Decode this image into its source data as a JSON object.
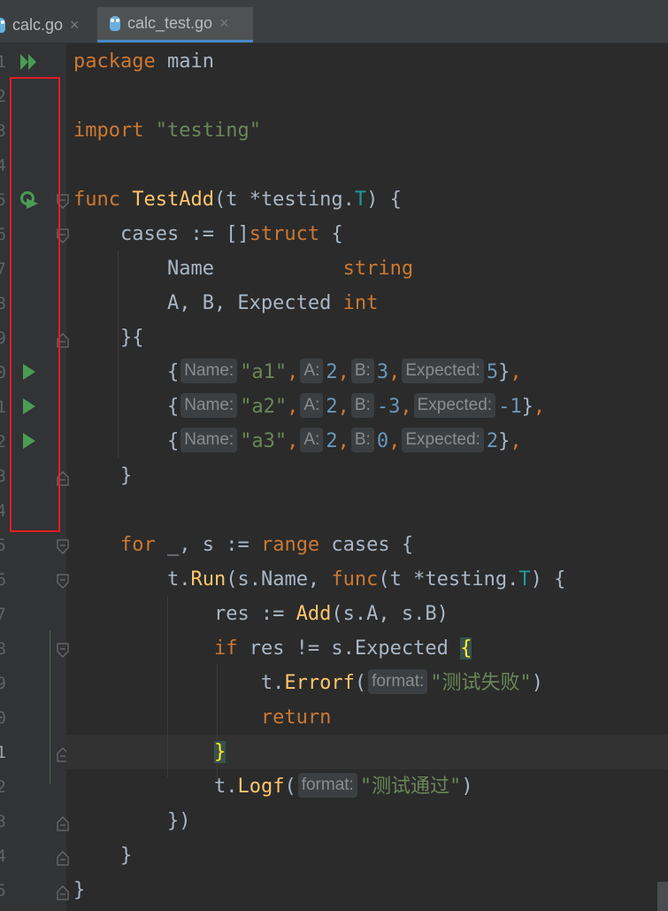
{
  "tabs": [
    {
      "label": "calc.go",
      "close": "×",
      "active": false
    },
    {
      "label": "calc_test.go",
      "close": "×",
      "active": true
    }
  ],
  "gutter": {
    "line_numbers": [
      "1",
      "2",
      "3",
      "4",
      "5",
      "6",
      "7",
      "8",
      "9",
      "0",
      "1",
      "2",
      "3",
      "4",
      "5",
      "6",
      "7",
      "8",
      "9",
      "0",
      "1",
      "2",
      "3",
      "4",
      "5"
    ],
    "current_line": 21
  },
  "code": {
    "l1": {
      "kw": "package",
      "rest": " main"
    },
    "l3": {
      "kw": "import",
      "str": "\"testing\""
    },
    "l5": {
      "kw": "func",
      "fn": "TestAdd",
      "p1": "(t *",
      "t1": "testing",
      "p2": ".",
      "t2": "T",
      "p3": ") {"
    },
    "l6": {
      "a": "    cases := []",
      "kw": "struct",
      "b": " {"
    },
    "l7": {
      "a": "        Name           ",
      "kw": "string"
    },
    "l8": {
      "a": "        A, B, Expected ",
      "kw": "int"
    },
    "l9": {
      "a": "    }{"
    },
    "cases": [
      {
        "name_hint": "Name:",
        "name": "\"a1\"",
        "a_hint": "A:",
        "a": "2",
        "b_hint": "B:",
        "b": "3",
        "e_hint": "Expected:",
        "e": "5"
      },
      {
        "name_hint": "Name:",
        "name": "\"a2\"",
        "a_hint": "A:",
        "a": "2",
        "b_hint": "B:",
        "b": "-3",
        "e_hint": "Expected:",
        "e": "-1"
      },
      {
        "name_hint": "Name:",
        "name": "\"a3\"",
        "a_hint": "A:",
        "a": "2",
        "b_hint": "B:",
        "b": "0",
        "e_hint": "Expected:",
        "e": "2"
      }
    ],
    "l13": {
      "a": "    }"
    },
    "l15": {
      "kw": "for",
      "a": " _, s := ",
      "kw2": "range",
      "b": " cases {"
    },
    "l16": {
      "a": "t.",
      "fn": "Run",
      "b": "(s.Name, ",
      "kw": "func",
      "c": "(t *",
      "t1": "testing",
      "d": ".",
      "t2": "T",
      "e": ") {"
    },
    "l17": {
      "a": "res := ",
      "fn": "Add",
      "b": "(s.A, s.B)"
    },
    "l18": {
      "kw": "if",
      "a": " res != s.Expected ",
      "brace": "{"
    },
    "l19": {
      "a": "t.",
      "fn": "Errorf",
      "b": "(",
      "hint": "format:",
      "str": "\"测试失败\"",
      "c": ")"
    },
    "l20": {
      "kw": "return"
    },
    "l21": {
      "brace": "}"
    },
    "l22": {
      "a": "t.",
      "fn": "Logf",
      "b": "(",
      "hint": "format:",
      "str": "\"测试通过\"",
      "c": ")"
    },
    "l23": {
      "a": "})"
    },
    "l24": {
      "a": "}"
    },
    "l25": {
      "a": "}"
    }
  },
  "colors": {
    "annotation_box": "#e01e24",
    "run_icon": "#499c54",
    "background": "#2b2b2b"
  }
}
